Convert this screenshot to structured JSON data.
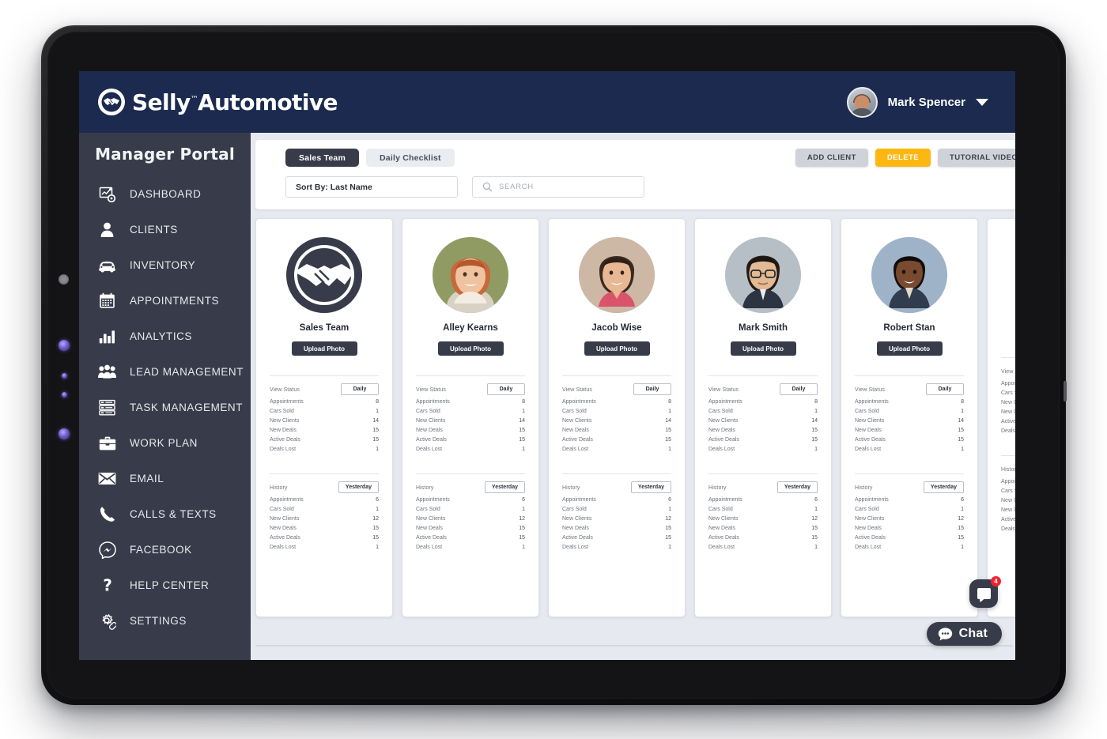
{
  "topbar": {
    "brand_name": "Selly",
    "brand_name2": "Automotive",
    "brand_tm": "™",
    "user_name": "Mark Spencer"
  },
  "sidebar": {
    "title": "Manager Portal",
    "items": [
      {
        "label": "DASHBOARD",
        "icon": "dashboard-icon"
      },
      {
        "label": "CLIENTS",
        "icon": "person-icon"
      },
      {
        "label": "INVENTORY",
        "icon": "car-icon"
      },
      {
        "label": "APPOINTMENTS",
        "icon": "calendar-icon"
      },
      {
        "label": "ANALYTICS",
        "icon": "bar-chart-icon"
      },
      {
        "label": "LEAD MANAGEMENT",
        "icon": "people-group-icon"
      },
      {
        "label": "TASK MANAGEMENT",
        "icon": "task-list-icon"
      },
      {
        "label": "WORK PLAN",
        "icon": "briefcase-icon"
      },
      {
        "label": "EMAIL",
        "icon": "envelope-icon"
      },
      {
        "label": "CALLS & TEXTS",
        "icon": "phone-icon"
      },
      {
        "label": "FACEBOOK",
        "icon": "messenger-icon"
      },
      {
        "label": "HELP CENTER",
        "icon": "question-mark-icon"
      },
      {
        "label": "SETTINGS",
        "icon": "gear-icon"
      }
    ]
  },
  "toolbar": {
    "tabs": [
      {
        "label": "Sales Team",
        "active": true
      },
      {
        "label": "Daily Checklist",
        "active": false
      }
    ],
    "actions": [
      {
        "label": "ADD CLIENT",
        "style": "grey"
      },
      {
        "label": "DELETE",
        "style": "yellow"
      },
      {
        "label": "TUTORIAL VIDEOS",
        "style": "grey"
      }
    ],
    "sort_value": "Sort By: Last Name",
    "search_placeholder": "SEARCH",
    "search_value": ""
  },
  "cards": {
    "upload_label": "Upload Photo",
    "daily_title": "View Status",
    "daily_period": "Daily",
    "history_title": "History",
    "history_period": "Yesterday",
    "stat_labels": [
      "Appointments",
      "Cars Sold",
      "New Clients",
      "New Deals",
      "Active Deals",
      "Deals Lost"
    ],
    "daily_values": [
      "8",
      "1",
      "14",
      "15",
      "15",
      "1"
    ],
    "history_values": [
      "6",
      "1",
      "12",
      "15",
      "15",
      "1"
    ],
    "people": [
      {
        "name": "Sales Team",
        "photo": "handshake-logo"
      },
      {
        "name": "Alley Kearns",
        "photo": "woman-red-hair"
      },
      {
        "name": "Jacob Wise",
        "photo": "young-man-curly"
      },
      {
        "name": "Mark Smith",
        "photo": "man-glasses"
      },
      {
        "name": "Robert Stan",
        "photo": "man-suit"
      },
      {
        "name": "",
        "photo": "partial-card"
      }
    ]
  },
  "chat": {
    "pill_label": "Chat",
    "badge_count": "4"
  },
  "colors": {
    "topbar_navy": "#1b2a4e",
    "sidebar_slate": "#383c4a",
    "accent_yellow": "#fcb713",
    "badge_red": "#f4212e",
    "main_bg": "#e6e9ef"
  }
}
